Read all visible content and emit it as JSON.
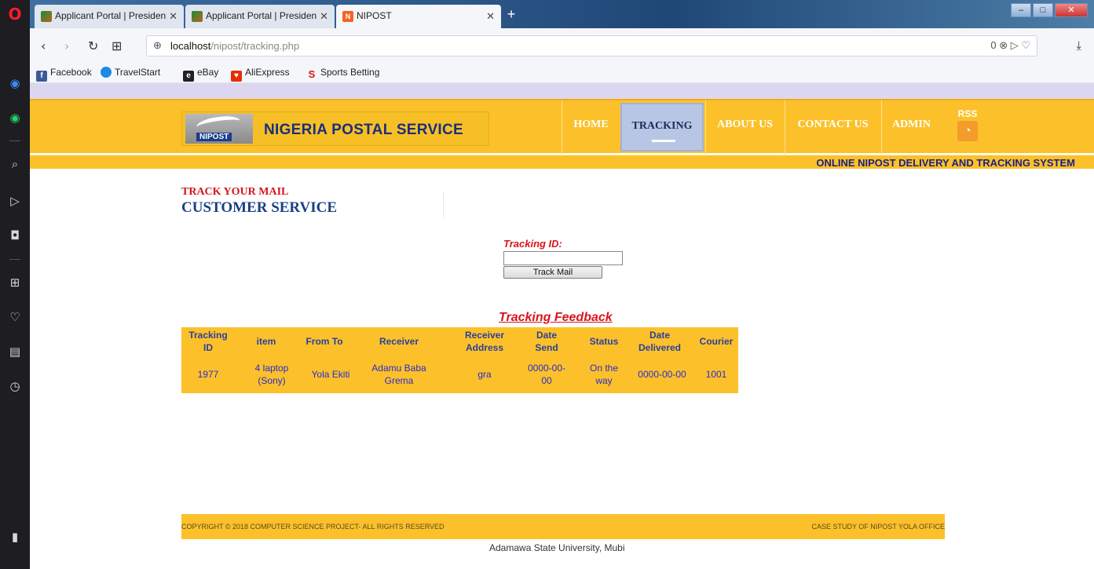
{
  "browser": {
    "tabs": [
      {
        "title": "Applicant Portal | Presiden",
        "icon": "coat-of-arms-icon",
        "active": false
      },
      {
        "title": "Applicant Portal | Presiden",
        "icon": "coat-of-arms-icon",
        "active": false
      },
      {
        "title": "NIPOST",
        "icon": "nipost-favicon",
        "active": true
      }
    ],
    "tab_close": "✕",
    "new_tab": "+",
    "window_buttons": [
      "–",
      "□",
      "✕"
    ],
    "url_host": "localhost",
    "url_path": "/nipost/tracking.php",
    "url_right": "0 ⊗ ▷ ♡",
    "toolbar_right": "⤓",
    "bookmarks": [
      {
        "label": "Facebook",
        "icon": "facebook-icon",
        "color": "#3b5998"
      },
      {
        "label": "TravelStart",
        "icon": "travelstart-icon",
        "color": "#1e88e5"
      },
      {
        "label": "eBay",
        "icon": "ebay-icon",
        "color": "#222222"
      },
      {
        "label": "AliExpress",
        "icon": "aliexpress-icon",
        "color": "#e62e04"
      },
      {
        "label": "Sports Betting",
        "icon": "sports-betting-icon",
        "color": "#d9141c"
      }
    ]
  },
  "header": {
    "logo_badge": "NIPOST",
    "logo_text": "NIGERIA POSTAL SERVICE",
    "menu": [
      {
        "label": "HOME",
        "active": false
      },
      {
        "label": "TRACKING",
        "active": true
      },
      {
        "label": "ABOUT US",
        "active": false
      },
      {
        "label": "CONTACT US",
        "active": false
      },
      {
        "label": "ADMIN",
        "active": false
      }
    ],
    "rss_label": "RSS",
    "tagline": "ONLINE NIPOST DELIVERY AND TRACKING SYSTEM"
  },
  "main": {
    "track_small": "TRACK YOUR MAIL",
    "track_big": "CUSTOMER SERVICE",
    "tracking_id_label": "Tracking ID:",
    "tracking_id_value": "",
    "track_button": "Track Mail",
    "feedback_title": "Tracking Feedback",
    "table": {
      "headers": [
        "Tracking ID",
        "item",
        "From To",
        "Receiver",
        "Receiver Address",
        "Date Send",
        "Status",
        "Date Delivered",
        "Courier"
      ],
      "rows": [
        [
          "1977",
          "4 laptop (Sony)",
          "Yola Ekiti",
          "Adamu Baba Grema",
          "gra",
          "0000-00-00",
          "On the way",
          "0000-00-00",
          "1001"
        ]
      ]
    }
  },
  "footer": {
    "copyright": "COPYRIGHT © 2018 COMPUTER SCIENCE PROJECT- ALL RIGHTS RESERVED",
    "case_study": "CASE STUDY OF NIPOST YOLA OFFICE",
    "university": "Adamawa State University, Mubi"
  },
  "colors": {
    "header_yellow": "#fcc12a",
    "nav_active": "#b8c6e6",
    "accent_red": "#d9141c",
    "title_blue": "#1b3f86"
  }
}
